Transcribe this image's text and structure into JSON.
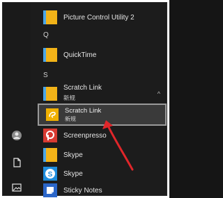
{
  "start_menu": {
    "items": [
      {
        "label": "Picture Control Utility 2",
        "kind": "folder"
      },
      {
        "header": "Q"
      },
      {
        "label": "QuickTime",
        "kind": "folder"
      },
      {
        "header": "S"
      },
      {
        "label": "Scratch Link",
        "sub": "新规",
        "kind": "folder",
        "expanded": true
      },
      {
        "label": "Scratch Link",
        "sub": "新规",
        "kind": "app",
        "selected": true
      },
      {
        "label": "Screenpresso",
        "kind": "app"
      },
      {
        "label": "Skype",
        "kind": "folder"
      },
      {
        "label": "Skype",
        "kind": "app"
      },
      {
        "label": "Sticky Notes",
        "kind": "app"
      }
    ],
    "collapse_glyph": "^",
    "colors": {
      "folder": "#f2b318",
      "skype": "#1f8ddc",
      "screenpresso": "#d83a32",
      "sticky": "#2b66c9",
      "scratch": "#f0b000",
      "arrow": "#e0262a",
      "selection_border": "#9a9a9a"
    }
  },
  "rail": {
    "icons": [
      "user-avatar-icon",
      "document-icon",
      "pictures-icon"
    ]
  }
}
